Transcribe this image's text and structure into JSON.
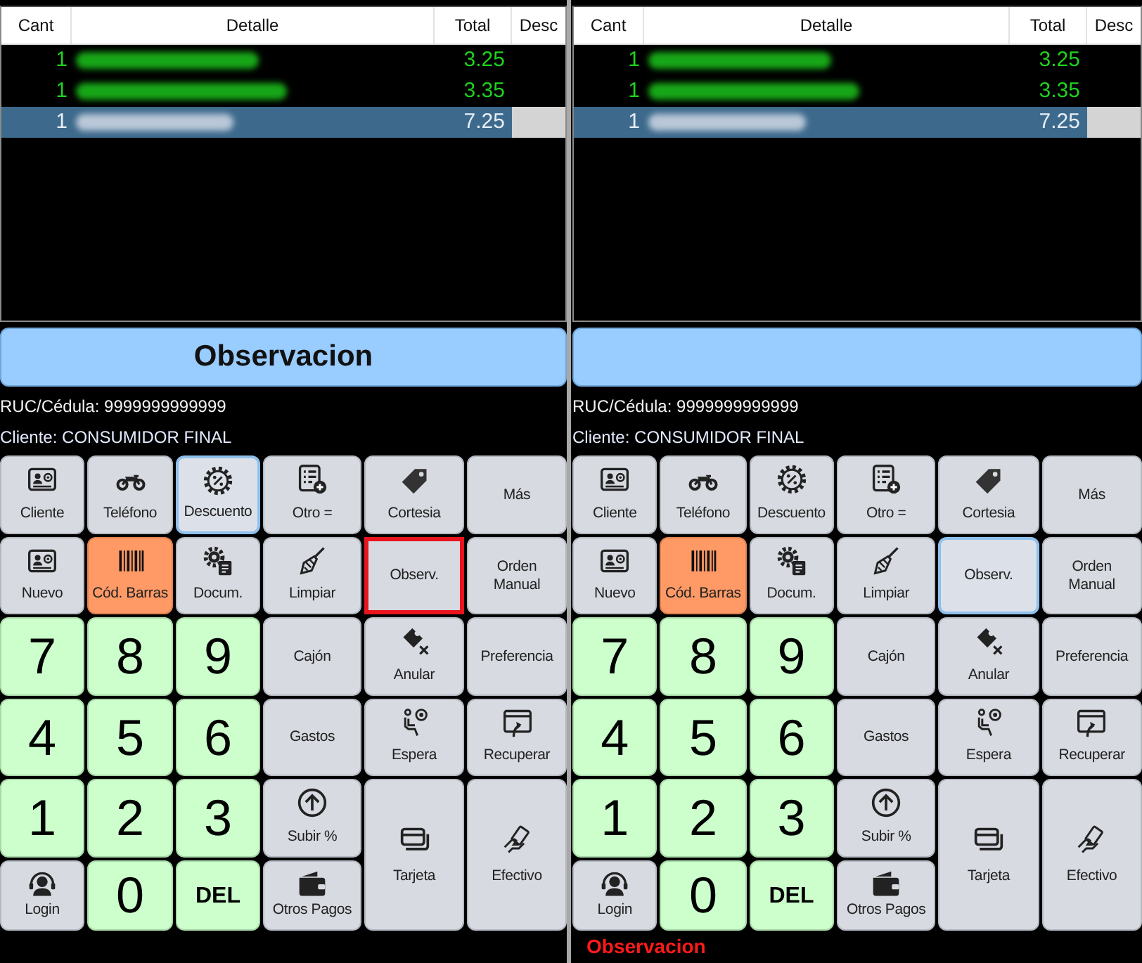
{
  "panels": [
    {
      "table": {
        "columns": [
          "Cant",
          "Detalle",
          "Total",
          "Desc"
        ],
        "rows": [
          {
            "cant": "1",
            "total": "3.25",
            "selected": false
          },
          {
            "cant": "1",
            "total": "3.35",
            "selected": false
          },
          {
            "cant": "1",
            "total": "7.25",
            "selected": true
          }
        ]
      },
      "banner_text": "Observacion",
      "customer": {
        "id_line": "RUC/Cédula: 9999999999999",
        "name_line": "Cliente: CONSUMIDOR FINAL"
      },
      "buttons": [
        {
          "label": "Cliente",
          "kind": "action",
          "focused": false,
          "highlighted": false
        },
        {
          "label": "Teléfono",
          "kind": "action",
          "focused": false,
          "highlighted": false
        },
        {
          "label": "Descuento",
          "kind": "action",
          "focused": true,
          "highlighted": false
        },
        {
          "label": "Otro =",
          "kind": "action",
          "focused": false,
          "highlighted": false
        },
        {
          "label": "Cortesia",
          "kind": "action",
          "focused": false,
          "highlighted": false
        },
        {
          "label": "Más",
          "kind": "action",
          "focused": false,
          "highlighted": false
        },
        {
          "label": "Nuevo",
          "kind": "action",
          "focused": false,
          "highlighted": false
        },
        {
          "label": "Cód. Barras",
          "kind": "accent",
          "focused": false,
          "highlighted": false
        },
        {
          "label": "Docum.",
          "kind": "action",
          "focused": false,
          "highlighted": false
        },
        {
          "label": "Limpiar",
          "kind": "action",
          "focused": false,
          "highlighted": false
        },
        {
          "label": "Observ.",
          "kind": "action",
          "focused": false,
          "highlighted": true
        },
        {
          "label": "Orden\nManual",
          "kind": "action",
          "focused": false,
          "highlighted": false
        },
        {
          "label": "7",
          "kind": "digit",
          "focused": false,
          "highlighted": false
        },
        {
          "label": "8",
          "kind": "digit",
          "focused": false,
          "highlighted": false
        },
        {
          "label": "9",
          "kind": "digit",
          "focused": false,
          "highlighted": false
        },
        {
          "label": "Cajón",
          "kind": "action",
          "focused": false,
          "highlighted": false
        },
        {
          "label": "Anular",
          "kind": "action",
          "focused": false,
          "highlighted": false
        },
        {
          "label": "Preferencia",
          "kind": "action",
          "focused": false,
          "highlighted": false
        },
        {
          "label": "4",
          "kind": "digit",
          "focused": false,
          "highlighted": false
        },
        {
          "label": "5",
          "kind": "digit",
          "focused": false,
          "highlighted": false
        },
        {
          "label": "6",
          "kind": "digit",
          "focused": false,
          "highlighted": false
        },
        {
          "label": "Gastos",
          "kind": "action",
          "focused": false,
          "highlighted": false
        },
        {
          "label": "Espera",
          "kind": "action",
          "focused": false,
          "highlighted": false
        },
        {
          "label": "Recuperar",
          "kind": "action",
          "focused": false,
          "highlighted": false
        },
        {
          "label": "1",
          "kind": "digit",
          "focused": false,
          "highlighted": false
        },
        {
          "label": "2",
          "kind": "digit",
          "focused": false,
          "highlighted": false
        },
        {
          "label": "3",
          "kind": "digit",
          "focused": false,
          "highlighted": false
        },
        {
          "label": "Subir %",
          "kind": "action",
          "focused": false,
          "highlighted": false
        },
        {
          "label": "Tarjeta",
          "kind": "action",
          "focused": false,
          "highlighted": false
        },
        {
          "label": "Efectivo",
          "kind": "action",
          "focused": false,
          "highlighted": false
        },
        {
          "label": "Login",
          "kind": "action",
          "focused": false,
          "highlighted": false
        },
        {
          "label": "0",
          "kind": "digit",
          "focused": false,
          "highlighted": false
        },
        {
          "label": "DEL",
          "kind": "command",
          "focused": false,
          "highlighted": false
        },
        {
          "label": "Otros Pagos",
          "kind": "action",
          "focused": false,
          "highlighted": false
        }
      ]
    },
    {
      "table": {
        "columns": [
          "Cant",
          "Detalle",
          "Total",
          "Desc"
        ],
        "rows": [
          {
            "cant": "1",
            "total": "3.25",
            "selected": false
          },
          {
            "cant": "1",
            "total": "3.35",
            "selected": false
          },
          {
            "cant": "1",
            "total": "7.25",
            "selected": true
          }
        ]
      },
      "customer": {
        "id_line": "RUC/Cédula: 9999999999999",
        "name_line": "Cliente: CONSUMIDOR FINAL"
      },
      "buttons": [
        {
          "label": "Cliente",
          "kind": "action",
          "focused": false,
          "highlighted": false
        },
        {
          "label": "Teléfono",
          "kind": "action",
          "focused": false,
          "highlighted": false
        },
        {
          "label": "Descuento",
          "kind": "action",
          "focused": false,
          "highlighted": false
        },
        {
          "label": "Otro =",
          "kind": "action",
          "focused": false,
          "highlighted": false
        },
        {
          "label": "Cortesia",
          "kind": "action",
          "focused": false,
          "highlighted": false
        },
        {
          "label": "Más",
          "kind": "action",
          "focused": false,
          "highlighted": false
        },
        {
          "label": "Nuevo",
          "kind": "action",
          "focused": false,
          "highlighted": false
        },
        {
          "label": "Cód. Barras",
          "kind": "accent",
          "focused": false,
          "highlighted": false
        },
        {
          "label": "Docum.",
          "kind": "action",
          "focused": false,
          "highlighted": false
        },
        {
          "label": "Limpiar",
          "kind": "action",
          "focused": false,
          "highlighted": false
        },
        {
          "label": "Observ.",
          "kind": "action",
          "focused": true,
          "highlighted": false
        },
        {
          "label": "Orden\nManual",
          "kind": "action",
          "focused": false,
          "highlighted": false
        },
        {
          "label": "7",
          "kind": "digit",
          "focused": false,
          "highlighted": false
        },
        {
          "label": "8",
          "kind": "digit",
          "focused": false,
          "highlighted": false
        },
        {
          "label": "9",
          "kind": "digit",
          "focused": false,
          "highlighted": false
        },
        {
          "label": "Cajón",
          "kind": "action",
          "focused": false,
          "highlighted": false
        },
        {
          "label": "Anular",
          "kind": "action",
          "focused": false,
          "highlighted": false
        },
        {
          "label": "Preferencia",
          "kind": "action",
          "focused": false,
          "highlighted": false
        },
        {
          "label": "4",
          "kind": "digit",
          "focused": false,
          "highlighted": false
        },
        {
          "label": "5",
          "kind": "digit",
          "focused": false,
          "highlighted": false
        },
        {
          "label": "6",
          "kind": "digit",
          "focused": false,
          "highlighted": false
        },
        {
          "label": "Gastos",
          "kind": "action",
          "focused": false,
          "highlighted": false
        },
        {
          "label": "Espera",
          "kind": "action",
          "focused": false,
          "highlighted": false
        },
        {
          "label": "Recuperar",
          "kind": "action",
          "focused": false,
          "highlighted": false
        },
        {
          "label": "1",
          "kind": "digit",
          "focused": false,
          "highlighted": false
        },
        {
          "label": "2",
          "kind": "digit",
          "focused": false,
          "highlighted": false
        },
        {
          "label": "3",
          "kind": "digit",
          "focused": false,
          "highlighted": false
        },
        {
          "label": "Subir %",
          "kind": "action",
          "focused": false,
          "highlighted": false
        },
        {
          "label": "Tarjeta",
          "kind": "action",
          "focused": false,
          "highlighted": false
        },
        {
          "label": "Efectivo",
          "kind": "action",
          "focused": false,
          "highlighted": false
        },
        {
          "label": "Login",
          "kind": "action",
          "focused": false,
          "highlighted": false
        },
        {
          "label": "0",
          "kind": "digit",
          "focused": false,
          "highlighted": false
        },
        {
          "label": "DEL",
          "kind": "command",
          "focused": false,
          "highlighted": false
        },
        {
          "label": "Otros Pagos",
          "kind": "action",
          "focused": false,
          "highlighted": false
        }
      ],
      "status": "Observacion"
    }
  ]
}
